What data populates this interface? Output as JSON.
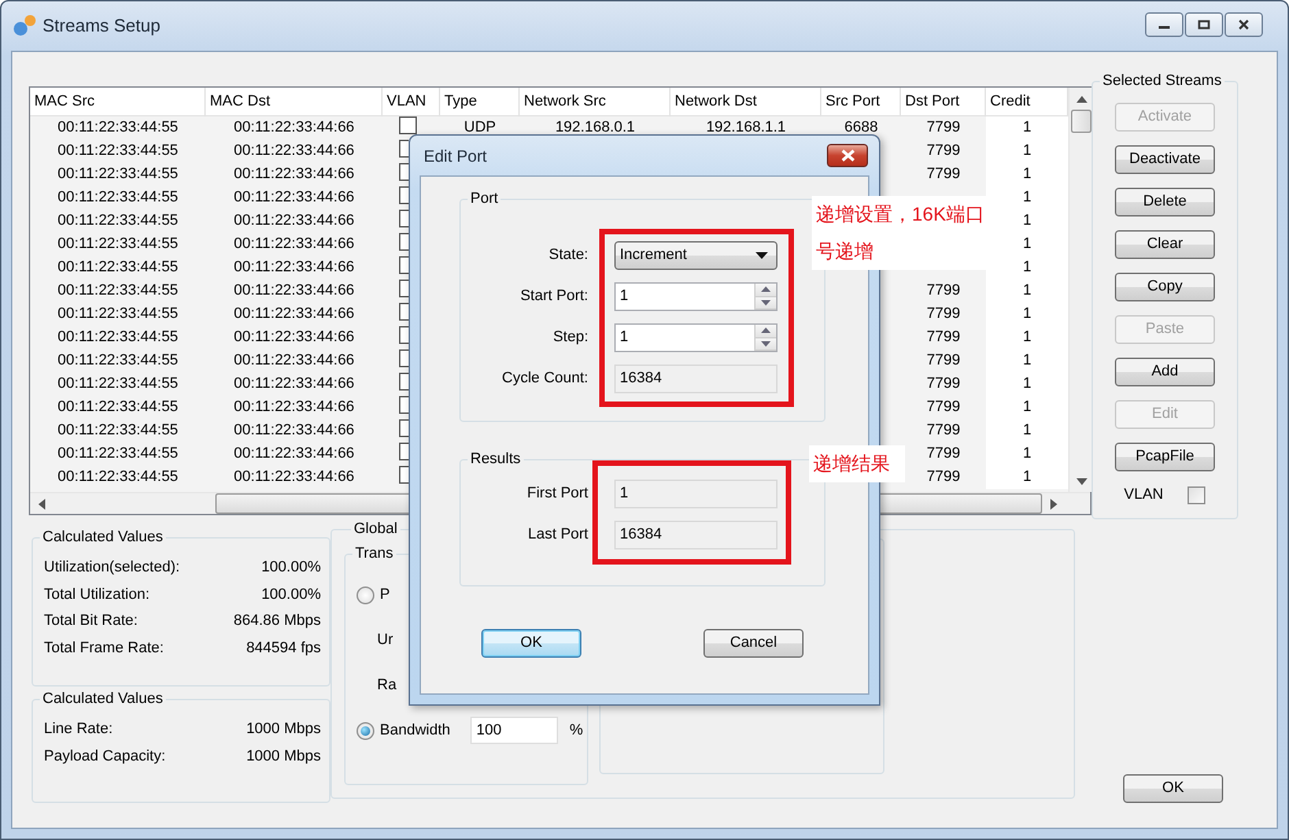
{
  "window": {
    "title": "Streams Setup"
  },
  "table": {
    "columns": [
      {
        "label": "MAC Src",
        "kind": "text"
      },
      {
        "label": "MAC Dst",
        "kind": "text"
      },
      {
        "label": "VLAN",
        "kind": "checkbox"
      },
      {
        "label": "Type",
        "kind": "text"
      },
      {
        "label": "Network Src",
        "kind": "text"
      },
      {
        "label": "Network Dst",
        "kind": "text"
      },
      {
        "label": "Src Port",
        "kind": "text"
      },
      {
        "label": "Dst Port",
        "kind": "text"
      },
      {
        "label": "Credit",
        "kind": "text"
      }
    ],
    "rows": [
      {
        "checked": false,
        "cells": [
          "00:11:22:33:44:55",
          "00:11:22:33:44:66",
          null,
          "UDP",
          "192.168.0.1",
          "192.168.1.1",
          "6688",
          "7799",
          "1"
        ]
      },
      {
        "checked": false,
        "cells": [
          "00:11:22:33:44:55",
          "00:11:22:33:44:66",
          null,
          null,
          null,
          null,
          null,
          "7799",
          "1"
        ]
      },
      {
        "checked": false,
        "cells": [
          "00:11:22:33:44:55",
          "00:11:22:33:44:66",
          null,
          null,
          null,
          null,
          null,
          "7799",
          "1"
        ]
      },
      {
        "checked": false,
        "cells": [
          "00:11:22:33:44:55",
          "00:11:22:33:44:66",
          null,
          null,
          null,
          null,
          null,
          null,
          "1"
        ]
      },
      {
        "checked": false,
        "cells": [
          "00:11:22:33:44:55",
          "00:11:22:33:44:66",
          null,
          null,
          null,
          null,
          null,
          null,
          "1"
        ]
      },
      {
        "checked": false,
        "cells": [
          "00:11:22:33:44:55",
          "00:11:22:33:44:66",
          null,
          null,
          null,
          null,
          null,
          null,
          "1"
        ]
      },
      {
        "checked": false,
        "cells": [
          "00:11:22:33:44:55",
          "00:11:22:33:44:66",
          null,
          null,
          null,
          null,
          null,
          null,
          "1"
        ]
      },
      {
        "checked": false,
        "cells": [
          "00:11:22:33:44:55",
          "00:11:22:33:44:66",
          null,
          null,
          null,
          null,
          null,
          "7799",
          "1"
        ]
      },
      {
        "checked": false,
        "cells": [
          "00:11:22:33:44:55",
          "00:11:22:33:44:66",
          null,
          null,
          null,
          null,
          null,
          "7799",
          "1"
        ]
      },
      {
        "checked": false,
        "cells": [
          "00:11:22:33:44:55",
          "00:11:22:33:44:66",
          null,
          null,
          null,
          null,
          null,
          "7799",
          "1"
        ]
      },
      {
        "checked": false,
        "cells": [
          "00:11:22:33:44:55",
          "00:11:22:33:44:66",
          null,
          null,
          null,
          null,
          null,
          "7799",
          "1"
        ]
      },
      {
        "checked": false,
        "cells": [
          "00:11:22:33:44:55",
          "00:11:22:33:44:66",
          null,
          null,
          null,
          null,
          null,
          "7799",
          "1"
        ]
      },
      {
        "checked": false,
        "cells": [
          "00:11:22:33:44:55",
          "00:11:22:33:44:66",
          null,
          null,
          null,
          null,
          null,
          "7799",
          "1"
        ]
      },
      {
        "checked": false,
        "cells": [
          "00:11:22:33:44:55",
          "00:11:22:33:44:66",
          null,
          null,
          null,
          null,
          null,
          "7799",
          "1"
        ]
      },
      {
        "checked": false,
        "cells": [
          "00:11:22:33:44:55",
          "00:11:22:33:44:66",
          null,
          null,
          null,
          null,
          null,
          "7799",
          "1"
        ]
      },
      {
        "checked": false,
        "cells": [
          "00:11:22:33:44:55",
          "00:11:22:33:44:66",
          null,
          null,
          null,
          null,
          null,
          "7799",
          "1"
        ]
      }
    ]
  },
  "selected_streams": {
    "title": "Selected Streams",
    "buttons": [
      {
        "label": "Activate",
        "disabled": true
      },
      {
        "label": "Deactivate",
        "disabled": false
      },
      {
        "label": "Delete",
        "disabled": false
      },
      {
        "label": "Clear",
        "disabled": false
      },
      {
        "label": "Copy",
        "disabled": false
      },
      {
        "label": "Paste",
        "disabled": true
      },
      {
        "label": "Add",
        "disabled": false
      },
      {
        "label": "Edit",
        "disabled": true
      },
      {
        "label": "PcapFile",
        "disabled": false
      }
    ],
    "vlan": {
      "label": "VLAN",
      "checked": false
    }
  },
  "calculated_groups": [
    {
      "title": "Calculated Values",
      "rows": [
        {
          "label": "Utilization(selected):",
          "value": "100.00%"
        },
        {
          "label": "Total Utilization:",
          "value": "100.00%"
        },
        {
          "label": "Total Bit Rate:",
          "value": "864.86 Mbps"
        },
        {
          "label": "Total Frame Rate:",
          "value": "844594 fps"
        }
      ]
    },
    {
      "title": "Calculated Values",
      "rows": [
        {
          "label": "Line Rate:",
          "value": "1000 Mbps"
        },
        {
          "label": "Payload Capacity:",
          "value": "1000 Mbps"
        }
      ]
    }
  ],
  "global_group": {
    "title": "Global",
    "inner_title": "Trans",
    "options": [
      {
        "kind": "radio",
        "label": "P",
        "selected": false
      },
      {
        "kind": "label",
        "label": "Ur"
      },
      {
        "kind": "label",
        "label": "Ra"
      },
      {
        "kind": "radio",
        "label": "Bandwidth",
        "selected": true,
        "value": "100",
        "unit": "%"
      }
    ]
  },
  "ok_button": {
    "label": "OK"
  },
  "dialog": {
    "title": "Edit Port",
    "groups": [
      {
        "title": "Port",
        "fields": [
          {
            "label": "State:",
            "kind": "combo",
            "value": "Increment"
          },
          {
            "label": "Start Port:",
            "kind": "spin",
            "value": "1"
          },
          {
            "label": "Step:",
            "kind": "spin",
            "value": "1"
          },
          {
            "label": "Cycle Count:",
            "kind": "readonly",
            "value": "16384"
          }
        ]
      },
      {
        "title": "Results",
        "fields": [
          {
            "label": "First Port",
            "kind": "readonly",
            "value": "1"
          },
          {
            "label": "Last Port",
            "kind": "readonly",
            "value": "16384"
          }
        ]
      }
    ],
    "buttons": [
      {
        "label": "OK",
        "default": true
      },
      {
        "label": "Cancel",
        "default": false
      }
    ]
  },
  "annotations": [
    {
      "text": "递增设置，16K端口号递增"
    },
    {
      "text": "递增结果"
    }
  ]
}
